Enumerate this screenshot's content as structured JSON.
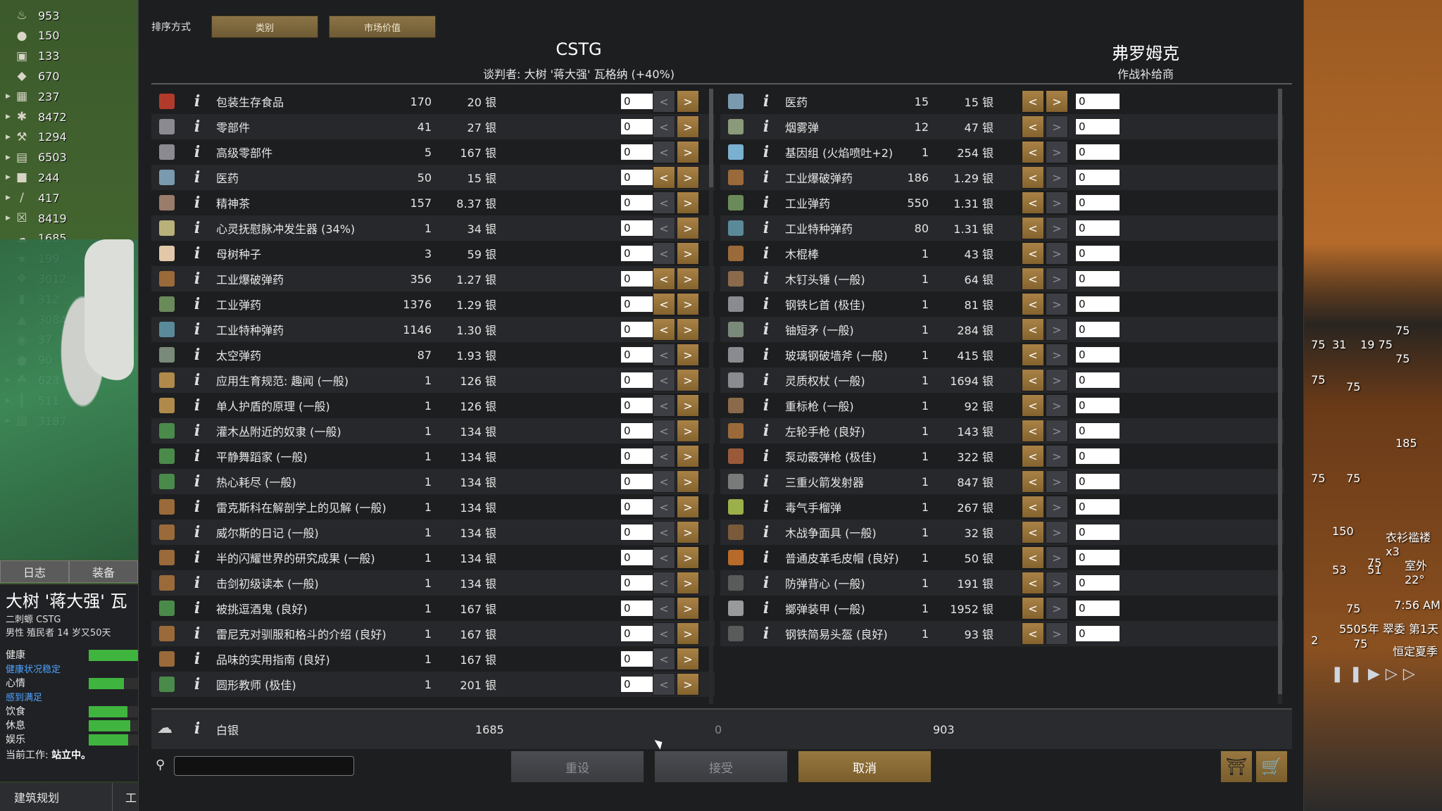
{
  "resources": [
    {
      "icon": "food-icon",
      "glyph": "♨",
      "value": "953",
      "expand": false
    },
    {
      "icon": "meat-icon",
      "glyph": "●",
      "value": "150",
      "expand": false
    },
    {
      "icon": "meal-icon",
      "glyph": "▣",
      "value": "133",
      "expand": false
    },
    {
      "icon": "crop-icon",
      "glyph": "◆",
      "value": "670",
      "expand": false
    },
    {
      "icon": "manufactured-icon",
      "glyph": "▦",
      "value": "237",
      "expand": true
    },
    {
      "icon": "raw-resource-icon",
      "glyph": "✱",
      "value": "8472",
      "expand": true
    },
    {
      "icon": "tool-icon",
      "glyph": "⚒",
      "value": "1294",
      "expand": true
    },
    {
      "icon": "item-icon",
      "glyph": "▤",
      "value": "6503",
      "expand": true
    },
    {
      "icon": "box-icon",
      "glyph": "■",
      "value": "244",
      "expand": true
    },
    {
      "icon": "weapon-icon",
      "glyph": "∕",
      "value": "417",
      "expand": true
    },
    {
      "icon": "material-icon",
      "glyph": "☒",
      "value": "8419",
      "expand": true
    },
    {
      "icon": "silver-icon",
      "glyph": "☁",
      "value": "1685",
      "expand": false
    },
    {
      "icon": "gold-icon",
      "glyph": "★",
      "value": "199",
      "expand": false
    },
    {
      "icon": "cloth-icon",
      "glyph": "❖",
      "value": "3012",
      "expand": false
    },
    {
      "icon": "fabric-icon",
      "glyph": "▮",
      "value": "312",
      "expand": false
    },
    {
      "icon": "wood-icon",
      "glyph": "▲",
      "value": "3084",
      "expand": false
    },
    {
      "icon": "stone-icon",
      "glyph": "◉",
      "value": "37",
      "expand": false
    },
    {
      "icon": "steel-icon",
      "glyph": "●",
      "value": "90",
      "expand": false
    },
    {
      "icon": "herb-icon",
      "glyph": "☘",
      "value": "623",
      "expand": true
    },
    {
      "icon": "furniture-icon",
      "glyph": "┃",
      "value": "511",
      "expand": true
    },
    {
      "icon": "chunk-icon",
      "glyph": "▧",
      "value": "3187",
      "expand": true
    }
  ],
  "left_tabs": {
    "log": "日志",
    "gear": "装备"
  },
  "pawn": {
    "name": "大树 '蒋大强' 瓦",
    "faction": "二刺螈 CSTG",
    "desc": "男性 殖民者 14 岁又50天",
    "needs": [
      {
        "label": "健康",
        "fill": 1.0,
        "blue": false
      },
      {
        "label": "健康状况稳定",
        "fill": null,
        "blue": true
      },
      {
        "label": "心情",
        "fill": 0.72,
        "blue": false
      },
      {
        "label": "感到满足",
        "fill": null,
        "blue": true
      },
      {
        "label": "饮食",
        "fill": 0.78,
        "blue": false
      },
      {
        "label": "休息",
        "fill": 0.84,
        "blue": false
      },
      {
        "label": "娱乐",
        "fill": 0.8,
        "blue": false
      }
    ],
    "work_label": "当前工作:",
    "work_value": "站立中。"
  },
  "arch_button": "建筑规划",
  "arch_button2": "工",
  "sort": {
    "label": "排序方式",
    "btn1": "类别",
    "btn2": "市场价值"
  },
  "colony": {
    "title": "CSTG",
    "negotiator": "谈判者: 大树 '蒋大强' 瓦格纳 (+40%)"
  },
  "trader": {
    "title": "弗罗姆克",
    "kind": "作战补给商"
  },
  "colony_items": [
    {
      "name": "包装生存食品",
      "qty": "170",
      "price": "20 银",
      "amount": "0",
      "left_on": false,
      "color": "#b23a2a"
    },
    {
      "name": "零部件",
      "qty": "41",
      "price": "27 银",
      "amount": "0",
      "left_on": false,
      "color": "#8a8a90"
    },
    {
      "name": "高级零部件",
      "qty": "5",
      "price": "167 银",
      "amount": "0",
      "left_on": false,
      "color": "#8a8a90"
    },
    {
      "name": "医药",
      "qty": "50",
      "price": "15 银",
      "amount": "0",
      "left_on": true,
      "color": "#7a9ab0"
    },
    {
      "name": "精神茶",
      "qty": "157",
      "price": "8.37 银",
      "amount": "0",
      "left_on": false,
      "color": "#9a7c6a"
    },
    {
      "name": "心灵抚慰脉冲发生器 (34%)",
      "qty": "1",
      "price": "34 银",
      "amount": "0",
      "left_on": false,
      "color": "#b8b27a"
    },
    {
      "name": "母树种子",
      "qty": "3",
      "price": "59 银",
      "amount": "0",
      "left_on": false,
      "color": "#e2c8a8"
    },
    {
      "name": "工业爆破弹药",
      "qty": "356",
      "price": "1.27 银",
      "amount": "0",
      "left_on": true,
      "color": "#9a6a3a"
    },
    {
      "name": "工业弹药",
      "qty": "1376",
      "price": "1.29 银",
      "amount": "0",
      "left_on": true,
      "color": "#6a8a5a"
    },
    {
      "name": "工业特种弹药",
      "qty": "1146",
      "price": "1.30 银",
      "amount": "0",
      "left_on": true,
      "color": "#5a8a9a"
    },
    {
      "name": "太空弹药",
      "qty": "87",
      "price": "1.93 银",
      "amount": "0",
      "left_on": false,
      "color": "#7a8a7a"
    },
    {
      "name": "应用生育规范: 趣闻 (一般)",
      "qty": "1",
      "price": "126 银",
      "amount": "0",
      "left_on": false,
      "color": "#b08a4a"
    },
    {
      "name": "单人护盾的原理 (一般)",
      "qty": "1",
      "price": "126 银",
      "amount": "0",
      "left_on": false,
      "color": "#b08a4a"
    },
    {
      "name": "灌木丛附近的奴隶 (一般)",
      "qty": "1",
      "price": "134 银",
      "amount": "0",
      "left_on": false,
      "color": "#4a8a4a"
    },
    {
      "name": "平静舞蹈家 (一般)",
      "qty": "1",
      "price": "134 银",
      "amount": "0",
      "left_on": false,
      "color": "#4a8a4a"
    },
    {
      "name": "热心耗尽 (一般)",
      "qty": "1",
      "price": "134 银",
      "amount": "0",
      "left_on": false,
      "color": "#4a8a4a"
    },
    {
      "name": "雷克斯科在解剖学上的见解 (一般)",
      "qty": "1",
      "price": "134 银",
      "amount": "0",
      "left_on": false,
      "color": "#9a6a3a"
    },
    {
      "name": "威尔斯的日记 (一般)",
      "qty": "1",
      "price": "134 银",
      "amount": "0",
      "left_on": false,
      "color": "#9a6a3a"
    },
    {
      "name": "半的闪耀世界的研究成果 (一般)",
      "qty": "1",
      "price": "134 银",
      "amount": "0",
      "left_on": false,
      "color": "#9a6a3a"
    },
    {
      "name": "击剑初级读本 (一般)",
      "qty": "1",
      "price": "134 银",
      "amount": "0",
      "left_on": false,
      "color": "#9a6a3a"
    },
    {
      "name": "被挑逗酒鬼 (良好)",
      "qty": "1",
      "price": "167 银",
      "amount": "0",
      "left_on": false,
      "color": "#4a8a4a"
    },
    {
      "name": "雷尼克对驯服和格斗的介绍 (良好)",
      "qty": "1",
      "price": "167 银",
      "amount": "0",
      "left_on": false,
      "color": "#9a6a3a"
    },
    {
      "name": "品味的实用指南 (良好)",
      "qty": "1",
      "price": "167 银",
      "amount": "0",
      "left_on": false,
      "color": "#9a6a3a"
    },
    {
      "name": "圆形教师 (极佳)",
      "qty": "1",
      "price": "201 银",
      "amount": "0",
      "left_on": false,
      "color": "#4a8a4a"
    }
  ],
  "trader_items": [
    {
      "name": "医药",
      "qty": "15",
      "price": "15 银",
      "amount": "0",
      "right_on": true,
      "color": "#7a9ab0"
    },
    {
      "name": "烟雾弹",
      "qty": "12",
      "price": "47 银",
      "amount": "0",
      "right_on": false,
      "color": "#8a9a7a"
    },
    {
      "name": "基因组 (火焰喷吐+2)",
      "qty": "1",
      "price": "254 银",
      "amount": "0",
      "right_on": false,
      "color": "#7ab0d0"
    },
    {
      "name": "工业爆破弹药",
      "qty": "186",
      "price": "1.29 银",
      "amount": "0",
      "right_on": false,
      "color": "#9a6a3a"
    },
    {
      "name": "工业弹药",
      "qty": "550",
      "price": "1.31 银",
      "amount": "0",
      "right_on": false,
      "color": "#6a8a5a"
    },
    {
      "name": "工业特种弹药",
      "qty": "80",
      "price": "1.31 银",
      "amount": "0",
      "right_on": false,
      "color": "#5a8a9a"
    },
    {
      "name": "木棍棒",
      "qty": "1",
      "price": "43 银",
      "amount": "0",
      "right_on": false,
      "color": "#9a6a3a"
    },
    {
      "name": "木钉头锤 (一般)",
      "qty": "1",
      "price": "64 银",
      "amount": "0",
      "right_on": false,
      "color": "#8a6a4a"
    },
    {
      "name": "钢铁匕首 (极佳)",
      "qty": "1",
      "price": "81 银",
      "amount": "0",
      "right_on": false,
      "color": "#8a8a90"
    },
    {
      "name": "铀短矛 (一般)",
      "qty": "1",
      "price": "284 银",
      "amount": "0",
      "right_on": false,
      "color": "#7a8a7a"
    },
    {
      "name": "玻璃钢破墙斧 (一般)",
      "qty": "1",
      "price": "415 银",
      "amount": "0",
      "right_on": false,
      "color": "#8a8a90"
    },
    {
      "name": "灵质权杖 (一般)",
      "qty": "1",
      "price": "1694 银",
      "amount": "0",
      "right_on": false,
      "color": "#8a8a90"
    },
    {
      "name": "重标枪 (一般)",
      "qty": "1",
      "price": "92 银",
      "amount": "0",
      "right_on": false,
      "color": "#8a6a4a"
    },
    {
      "name": "左轮手枪 (良好)",
      "qty": "1",
      "price": "143 银",
      "amount": "0",
      "right_on": false,
      "color": "#9a6a3a"
    },
    {
      "name": "泵动霰弹枪 (极佳)",
      "qty": "1",
      "price": "322 银",
      "amount": "0",
      "right_on": false,
      "color": "#9a5a3a"
    },
    {
      "name": "三重火箭发射器",
      "qty": "1",
      "price": "847 银",
      "amount": "0",
      "right_on": false,
      "color": "#7a7a7a"
    },
    {
      "name": "毒气手榴弹",
      "qty": "1",
      "price": "267 银",
      "amount": "0",
      "right_on": false,
      "color": "#9ab04a"
    },
    {
      "name": "木战争面具 (一般)",
      "qty": "1",
      "price": "32 银",
      "amount": "0",
      "right_on": false,
      "color": "#7a5a3a"
    },
    {
      "name": "普通皮革毛皮帽 (良好)",
      "qty": "1",
      "price": "50 银",
      "amount": "0",
      "right_on": false,
      "color": "#b86a2a"
    },
    {
      "name": "防弹背心 (一般)",
      "qty": "1",
      "price": "191 银",
      "amount": "0",
      "right_on": false,
      "color": "#5a5a5a"
    },
    {
      "name": "擲弹装甲 (一般)",
      "qty": "1",
      "price": "1952 银",
      "amount": "0",
      "right_on": false,
      "color": "#9a9a9a"
    },
    {
      "name": "钢铁简易头盔 (良好)",
      "qty": "1",
      "price": "93 银",
      "amount": "0",
      "right_on": false,
      "color": "#5a5a5a"
    }
  ],
  "silver": {
    "name": "白银",
    "colony_qty": "1685",
    "balance": "0",
    "trader_qty": "903"
  },
  "buttons": {
    "reset": "重设",
    "accept": "接受",
    "cancel": "取消"
  },
  "map": {
    "numbers": [
      "75",
      "31",
      "19 75",
      "75",
      "75",
      "75",
      "75",
      "185",
      "75",
      "75",
      "150",
      "75",
      "53",
      "51",
      "75",
      "2",
      "75"
    ],
    "location": "衣衫褴褛 x3",
    "temp": "室外 22°",
    "time": "7:56 AM",
    "date": "5505年 翠委 第1天",
    "season": "恒定夏季"
  }
}
